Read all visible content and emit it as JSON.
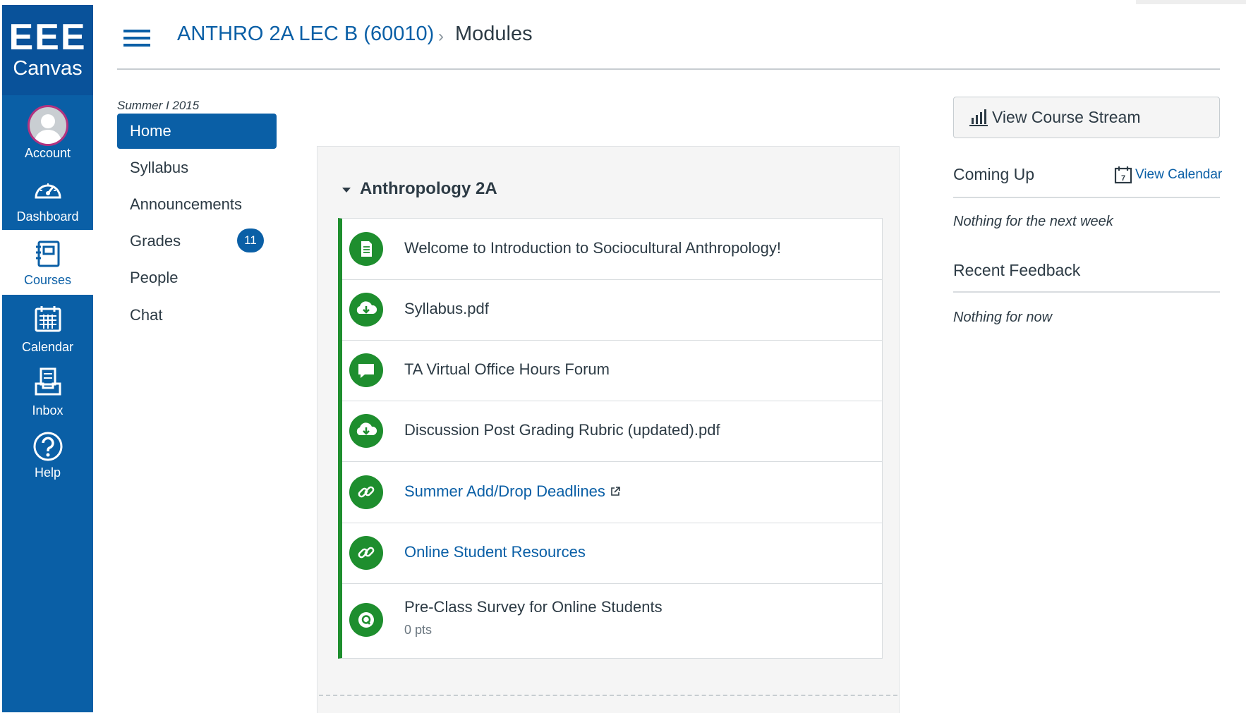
{
  "brand": {
    "line1": "EEE",
    "line2": "Canvas"
  },
  "global_nav": {
    "account": "Account",
    "dashboard": "Dashboard",
    "courses": "Courses",
    "calendar": "Calendar",
    "inbox": "Inbox",
    "help": "Help"
  },
  "breadcrumb": {
    "course": "ANTHRO 2A LEC B (60010)",
    "separator": "›",
    "current": "Modules"
  },
  "course_nav": {
    "term": "Summer I 2015",
    "items": [
      {
        "label": "Home",
        "active": true
      },
      {
        "label": "Syllabus"
      },
      {
        "label": "Announcements"
      },
      {
        "label": "Grades",
        "badge": "11"
      },
      {
        "label": "People"
      },
      {
        "label": "Chat"
      }
    ]
  },
  "module": {
    "title": "Anthropology 2A",
    "items": [
      {
        "title": "Welcome to Introduction to Sociocultural Anthropology!",
        "icon": "page-icon",
        "link": false
      },
      {
        "title": "Syllabus.pdf",
        "icon": "download-cloud-icon",
        "link": false
      },
      {
        "title": "TA Virtual Office Hours Forum",
        "icon": "discussion-icon",
        "link": false
      },
      {
        "title": "Discussion Post Grading Rubric (updated).pdf",
        "icon": "download-cloud-icon",
        "link": false
      },
      {
        "title": "Summer Add/Drop Deadlines",
        "icon": "link-icon",
        "link": true,
        "external": true
      },
      {
        "title": "Online Student Resources",
        "icon": "link-icon",
        "link": true
      },
      {
        "title": "Pre-Class Survey for Online Students",
        "icon": "quiz-icon",
        "link": false,
        "points": "0 pts"
      }
    ]
  },
  "sidebar": {
    "stream_button": "View Course Stream",
    "coming_up": "Coming Up",
    "view_calendar": "View Calendar",
    "calendar_day": "7",
    "coming_up_empty": "Nothing for the next week",
    "recent_feedback": "Recent Feedback",
    "feedback_empty": "Nothing for now"
  },
  "colors": {
    "brand_blue": "#0a5fa6",
    "module_green": "#1e8e2e",
    "text": "#2d3b45"
  }
}
